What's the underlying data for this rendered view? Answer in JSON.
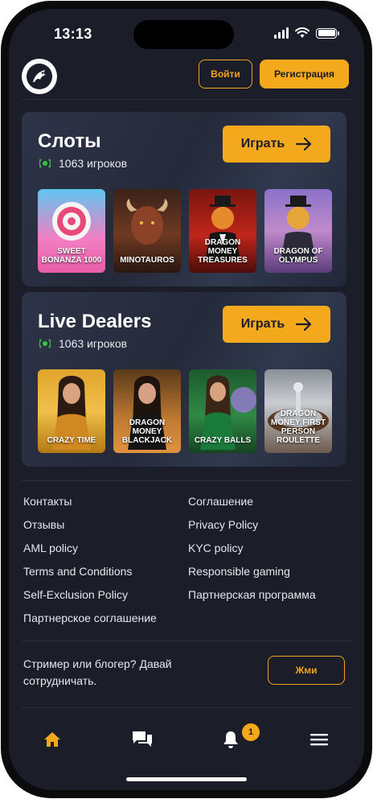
{
  "status_bar": {
    "time": "13:13"
  },
  "header": {
    "login_label": "Войти",
    "register_label": "Регистрация"
  },
  "sections": [
    {
      "title": "Слоты",
      "players": "1063 игроков",
      "play_label": "Играть",
      "games": [
        {
          "name": "SWEET BONANZA 1000"
        },
        {
          "name": "MINOTAUROS"
        },
        {
          "name": "DRAGON MONEY TREASURES"
        },
        {
          "name": "DRAGON OF OLYMPUS"
        }
      ]
    },
    {
      "title": "Live Dealers",
      "players": "1063 игроков",
      "play_label": "Играть",
      "games": [
        {
          "name": "CRAZY TIME"
        },
        {
          "name": "DRAGON MONEY BLACKJACK"
        },
        {
          "name": "CRAZY BALLS"
        },
        {
          "name": "DRAGON MONEY FIRST PERSON ROULETTE"
        }
      ]
    }
  ],
  "footer_links": {
    "left": [
      "Контакты",
      "Отзывы",
      "AML policy",
      "Terms and Conditions",
      "Self-Exclusion Policy",
      "Партнерское соглашение"
    ],
    "right": [
      "Соглашение",
      "Privacy Policy",
      "KYC policy",
      "Responsible gaming",
      "Партнерская программа"
    ]
  },
  "collab": {
    "text": "Стример или блогер? Давай сотрудничать.",
    "button_label": "Жми"
  },
  "bottom_nav": {
    "items": [
      "home-icon",
      "chat-icon",
      "bell-icon",
      "menu-icon"
    ],
    "notification_count": "1"
  },
  "colors": {
    "accent": "#f4a81c",
    "background": "#1b1d29",
    "card": "#2a3042"
  }
}
